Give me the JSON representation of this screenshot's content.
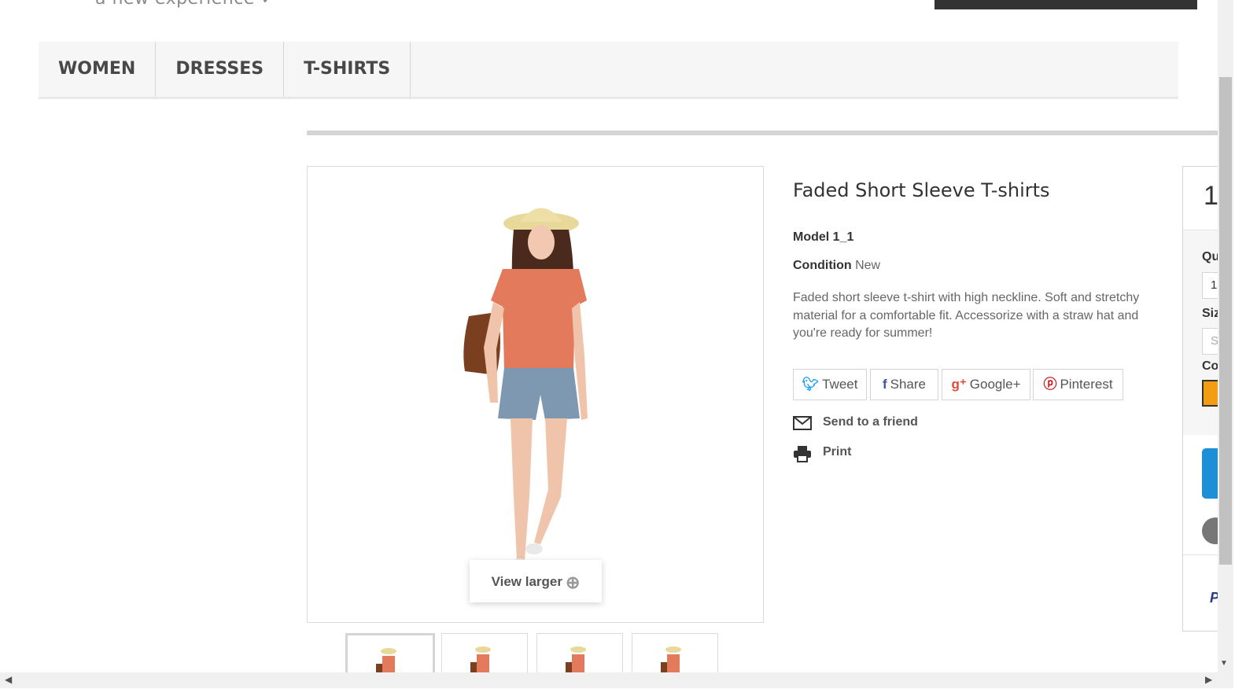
{
  "header": {
    "tagline": "a new experience"
  },
  "menu": {
    "items": [
      {
        "label": "WOMEN"
      },
      {
        "label": "DRESSES"
      },
      {
        "label": "T-SHIRTS"
      }
    ]
  },
  "product": {
    "title": "Faded Short Sleeve T-shirts",
    "model": "Model 1_1",
    "condition_label": "Condition",
    "condition_value": "New",
    "description": "Faded short sleeve t-shirt with high neckline. Soft and stretchy material for a comfortable fit. Accessorize with a straw hat and you're ready for summer!",
    "view_larger": "View larger",
    "social": [
      {
        "label": "Tweet",
        "icon": "twitter-icon"
      },
      {
        "label": "Share",
        "icon": "facebook-icon"
      },
      {
        "label": "Google+",
        "icon": "google-plus-icon"
      },
      {
        "label": "Pinterest",
        "icon": "pinterest-icon"
      }
    ],
    "send_to_friend": "Send to a friend",
    "print": "Print"
  },
  "buy_box": {
    "price_partial": "1",
    "quantity_label_partial": "Qu",
    "quantity_value": "1",
    "size_label_partial": "Siz",
    "size_value_partial": "S",
    "color_label_partial": "Co",
    "color_swatch": "#f39d12",
    "paypal_partial": "P"
  },
  "colors": {
    "accent_blue": "#1c8fd6",
    "twitter": "#1da1f2",
    "facebook": "#3b5998",
    "google": "#dd4b39",
    "pinterest": "#cb2027"
  }
}
